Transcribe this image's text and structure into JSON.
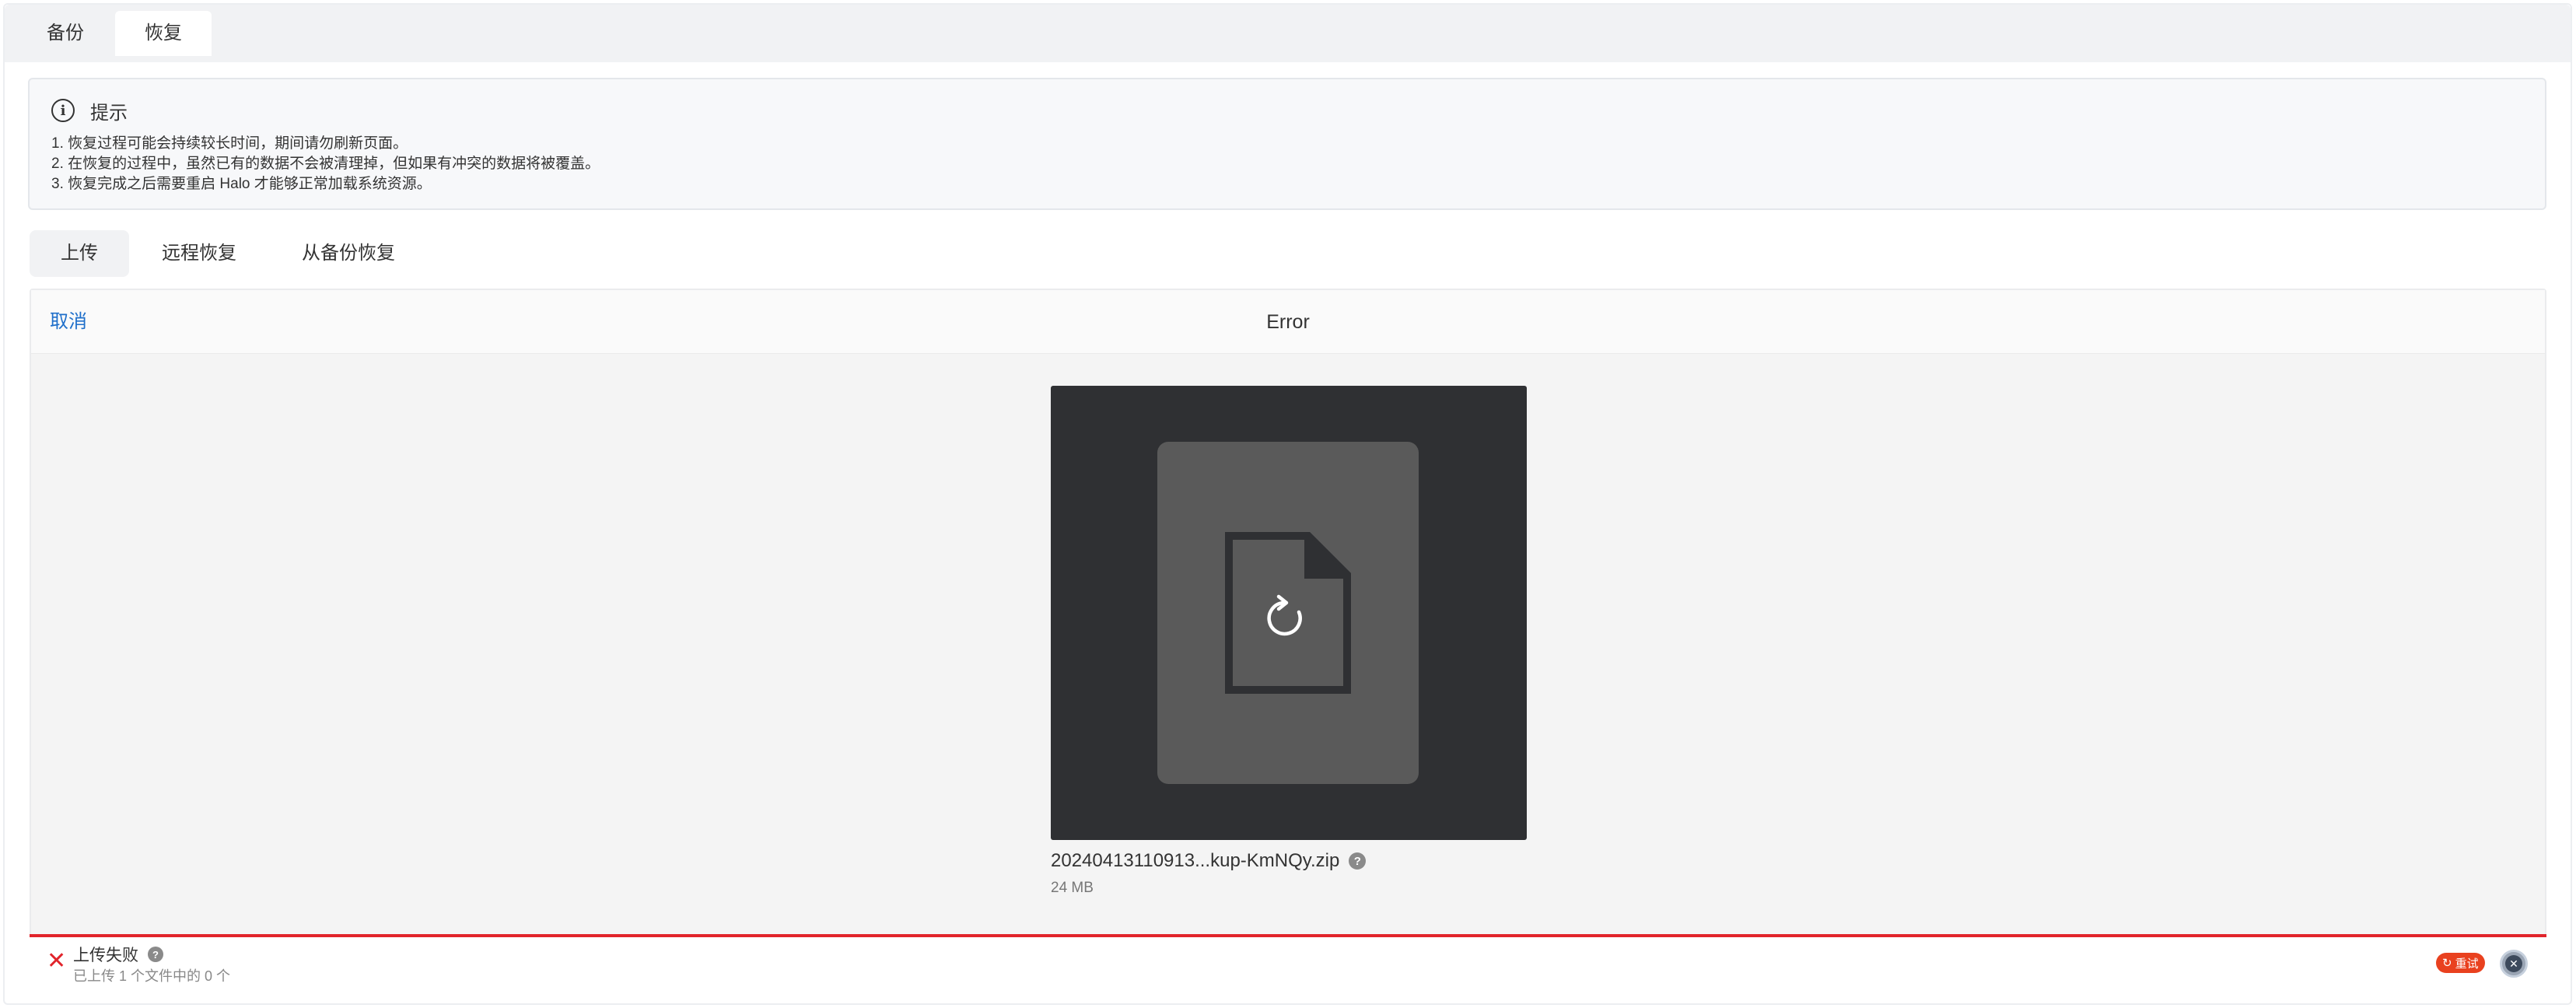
{
  "top_tabs": [
    {
      "label": "备份"
    },
    {
      "label": "恢复"
    }
  ],
  "notice": {
    "title": "提示",
    "lines": [
      "1. 恢复过程可能会持续较长时间，期间请勿刷新页面。",
      "2. 在恢复的过程中，虽然已有的数据不会被清理掉，但如果有冲突的数据将被覆盖。",
      "3. 恢复完成之后需要重启 Halo 才能够正常加载系统资源。"
    ]
  },
  "sub_tabs": [
    {
      "label": "上传"
    },
    {
      "label": "远程恢复"
    },
    {
      "label": "从备份恢复"
    }
  ],
  "uploader": {
    "cancel_label": "取消",
    "title": "Error",
    "file": {
      "name": "20240413110913...kup-KmNQy.zip",
      "size": "24 MB",
      "help_glyph": "?"
    },
    "status": {
      "title": "上传失败",
      "subtitle": "已上传 1 个文件中的 0 个",
      "retry_label": "重试",
      "error_color": "#e1242b"
    }
  },
  "icons": {
    "info": "info-circle-icon",
    "document_retry": "file-retry-icon",
    "error": "close-x-icon",
    "retry": "retry-icon",
    "cancel_upload": "close-circle-icon"
  }
}
